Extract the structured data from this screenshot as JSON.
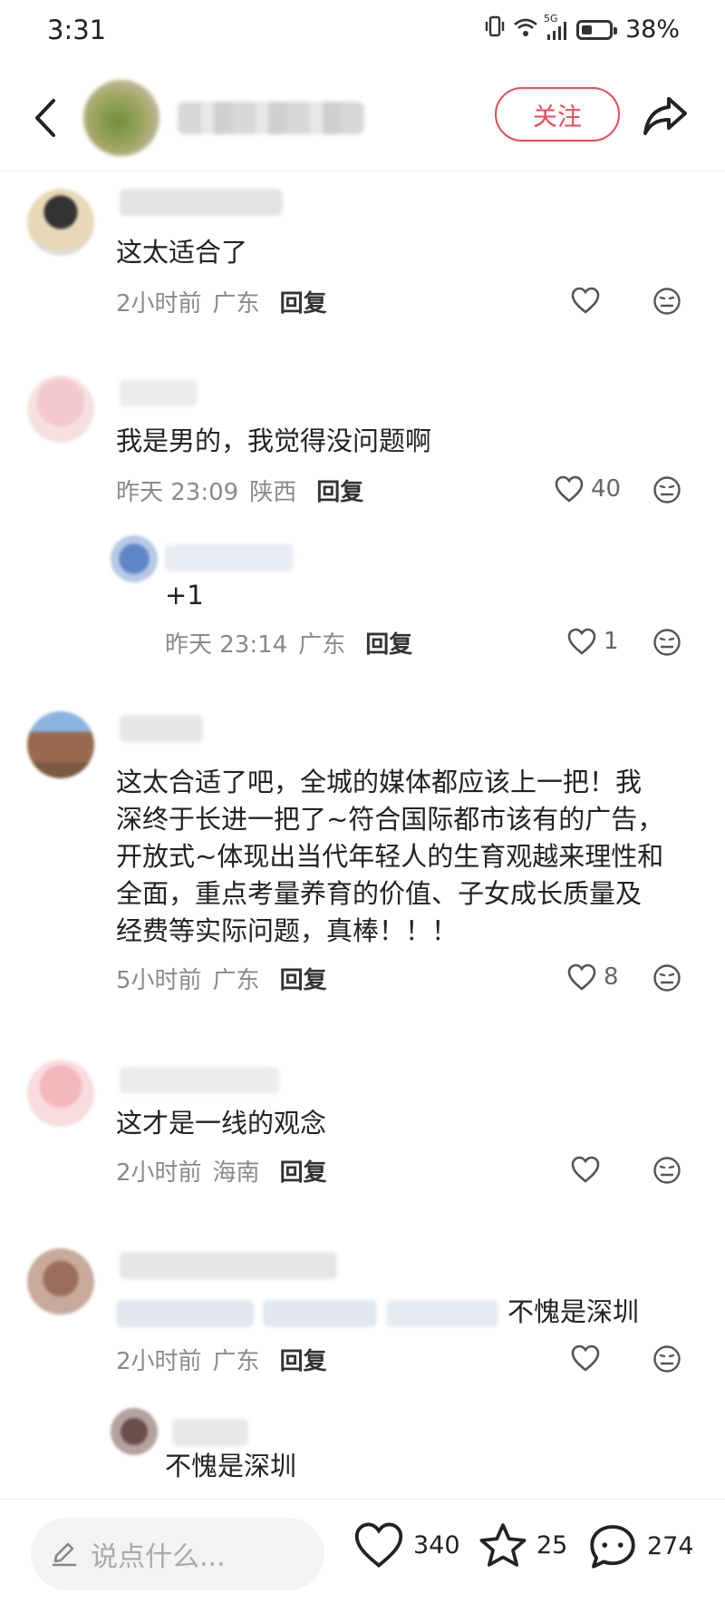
{
  "status_bar": {
    "time": "3:31",
    "network": "5G",
    "battery": "38%",
    "battery_level": 0.38
  },
  "header": {
    "follow_label": "关注"
  },
  "comments": [
    {
      "text": "这太适合了",
      "time": "2小时前",
      "location": "广东",
      "reply_label": "回复",
      "likes": ""
    },
    {
      "text": "我是男的，我觉得没问题啊",
      "time": "昨天 23:09",
      "location": "陕西",
      "reply_label": "回复",
      "likes": "40"
    },
    {
      "text": "+1",
      "time": "昨天 23:14",
      "location": "广东",
      "reply_label": "回复",
      "likes": "1"
    },
    {
      "lines": [
        "这太合适了吧，全城的媒体都应该上一把！我",
        "深终于长进一把了~符合国际都市该有的广告，",
        "开放式~体现出当代年轻人的生育观越来理性和",
        "全面，重点考量养育的价值、子女成长质量及",
        "经费等实际问题，真棒！！！"
      ],
      "time": "5小时前",
      "location": "广东",
      "reply_label": "回复",
      "likes": "8"
    },
    {
      "text": "这才是一线的观念",
      "time": "2小时前",
      "location": "海南",
      "reply_label": "回复",
      "likes": ""
    },
    {
      "text": "不愧是深圳",
      "time": "2小时前",
      "location": "广东",
      "reply_label": "回复",
      "likes": ""
    },
    {
      "text": "不愧是深圳"
    }
  ],
  "bottom_bar": {
    "input_placeholder": "说点什么...",
    "likes": "340",
    "favorites": "25",
    "comments": "274"
  }
}
